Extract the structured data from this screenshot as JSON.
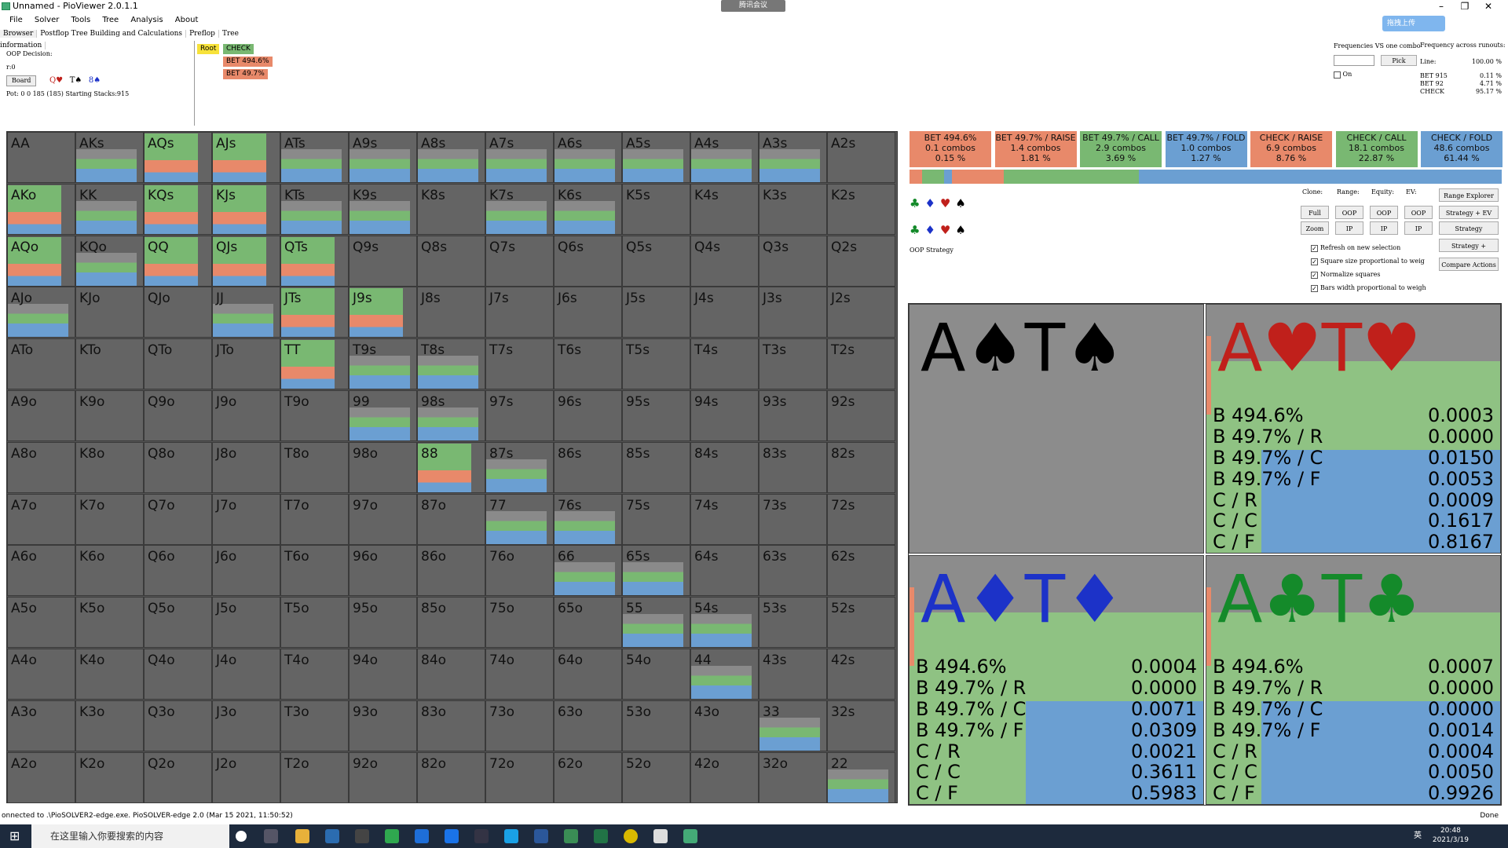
{
  "window": {
    "title": "Unnamed - PioViewer 2.0.1.1",
    "meeting_badge": "腾讯会议",
    "cloud_button": "拖拽上传"
  },
  "menu": [
    "File",
    "Solver",
    "Tools",
    "Tree",
    "Analysis",
    "About"
  ],
  "tabs": [
    "Browser",
    "Postflop Tree Building and Calculations",
    "Preflop",
    "Tree information"
  ],
  "left_info": {
    "decision": "OOP Decision:",
    "r": "r:0",
    "board_label": "Board",
    "board_cards": [
      "Q♥",
      "T♠",
      "8♠"
    ],
    "pot": "Pot: 0 0 185 (185) Starting Stacks:915"
  },
  "tree": {
    "root": "Root",
    "check": "CHECK",
    "bet1": "BET 494.6%",
    "bet2": "BET 49.7%"
  },
  "right_info": {
    "freq_title": "Frequencies VS one combo",
    "runouts_title": "Frequency across runouts:",
    "pick": "Pick",
    "on": "On",
    "line_label": "Line:",
    "line_value": "100.00 %",
    "rows": [
      {
        "label": "BET 915",
        "value": "0.11 %"
      },
      {
        "label": "BET 92",
        "value": "4.71 %"
      },
      {
        "label": "CHECK",
        "value": "95.17 %"
      }
    ]
  },
  "actions": [
    {
      "name": "BET 494.6%",
      "combos": "0.1 combos",
      "pct": "0.15 %",
      "color": "#e8896a"
    },
    {
      "name": "BET 49.7% / RAISE",
      "combos": "1.4 combos",
      "pct": "1.81 %",
      "color": "#e8896a"
    },
    {
      "name": "BET 49.7% / CALL",
      "combos": "2.9 combos",
      "pct": "3.69 %",
      "color": "#79b872"
    },
    {
      "name": "BET 49.7% / FOLD",
      "combos": "1.0 combos",
      "pct": "1.27 %",
      "color": "#6b9fd2"
    },
    {
      "name": "CHECK / RAISE",
      "combos": "6.9 combos",
      "pct": "8.76 %",
      "color": "#e8896a"
    },
    {
      "name": "CHECK / CALL",
      "combos": "18.1 combos",
      "pct": "22.87 %",
      "color": "#79b872"
    },
    {
      "name": "CHECK / FOLD",
      "combos": "48.6 combos",
      "pct": "61.44 %",
      "color": "#6b9fd2"
    }
  ],
  "suits": [
    "♣",
    "♦",
    "♥",
    "♠"
  ],
  "controls": {
    "clone": "Clone:",
    "range": "Range:",
    "equity": "Equity:",
    "ev": "EV:",
    "full": "Full",
    "zoom": "Zoom",
    "oop": "OOP",
    "ip": "IP",
    "range_explorer": "Range Explorer",
    "strategy_ev": "Strategy + EV",
    "strategy": "Strategy",
    "strategy_plus": "Strategy +",
    "compare": "Compare Actions",
    "checks": [
      "Refresh on new selection",
      "Square size proportional to weig",
      "Normalize squares",
      "Bars width proportional to weigh"
    ]
  },
  "oop_strategy": "OOP Strategy",
  "combos": [
    {
      "cards": [
        {
          "r": "A",
          "s": "♠"
        },
        {
          "r": "T",
          "s": "♠"
        }
      ],
      "color": "#000",
      "rows": []
    },
    {
      "cards": [
        {
          "r": "A",
          "s": "♥"
        },
        {
          "r": "T",
          "s": "♥"
        }
      ],
      "color": "#c0201b",
      "rows": [
        {
          "l": "B 494.6%",
          "v": "0.0003"
        },
        {
          "l": "B 49.7% / R",
          "v": "0.0000"
        },
        {
          "l": "B 49.7% / C",
          "v": "0.0150"
        },
        {
          "l": "B 49.7% / F",
          "v": "0.0053"
        },
        {
          "l": "C / R",
          "v": "0.0009"
        },
        {
          "l": "C / C",
          "v": "0.1617"
        },
        {
          "l": "C / F",
          "v": "0.8167"
        }
      ]
    },
    {
      "cards": [
        {
          "r": "A",
          "s": "♦"
        },
        {
          "r": "T",
          "s": "♦"
        }
      ],
      "color": "#1c32c8",
      "rows": [
        {
          "l": "B 494.6%",
          "v": "0.0004"
        },
        {
          "l": "B 49.7% / R",
          "v": "0.0000"
        },
        {
          "l": "B 49.7% / C",
          "v": "0.0071"
        },
        {
          "l": "B 49.7% / F",
          "v": "0.0309"
        },
        {
          "l": "C / R",
          "v": "0.0021"
        },
        {
          "l": "C / C",
          "v": "0.3611"
        },
        {
          "l": "C / F",
          "v": "0.5983"
        }
      ]
    },
    {
      "cards": [
        {
          "r": "A",
          "s": "♣"
        },
        {
          "r": "T",
          "s": "♣"
        }
      ],
      "color": "#148a2a",
      "rows": [
        {
          "l": "B 494.6%",
          "v": "0.0007"
        },
        {
          "l": "B 49.7% / R",
          "v": "0.0000"
        },
        {
          "l": "B 49.7% / C",
          "v": "0.0000"
        },
        {
          "l": "B 49.7% / F",
          "v": "0.0014"
        },
        {
          "l": "C / R",
          "v": "0.0004"
        },
        {
          "l": "C / C",
          "v": "0.0050"
        },
        {
          "l": "C / F",
          "v": "0.9926"
        }
      ]
    }
  ],
  "grid": [
    [
      "AA",
      "AKs",
      "AQs",
      "AJs",
      "ATs",
      "A9s",
      "A8s",
      "A7s",
      "A6s",
      "A5s",
      "A4s",
      "A3s",
      "A2s"
    ],
    [
      "AKo",
      "KK",
      "KQs",
      "KJs",
      "KTs",
      "K9s",
      "K8s",
      "K7s",
      "K6s",
      "K5s",
      "K4s",
      "K3s",
      "K2s"
    ],
    [
      "AQo",
      "KQo",
      "QQ",
      "QJs",
      "QTs",
      "Q9s",
      "Q8s",
      "Q7s",
      "Q6s",
      "Q5s",
      "Q4s",
      "Q3s",
      "Q2s"
    ],
    [
      "AJo",
      "KJo",
      "QJo",
      "JJ",
      "JTs",
      "J9s",
      "J8s",
      "J7s",
      "J6s",
      "J5s",
      "J4s",
      "J3s",
      "J2s"
    ],
    [
      "ATo",
      "KTo",
      "QTo",
      "JTo",
      "TT",
      "T9s",
      "T8s",
      "T7s",
      "T6s",
      "T5s",
      "T4s",
      "T3s",
      "T2s"
    ],
    [
      "A9o",
      "K9o",
      "Q9o",
      "J9o",
      "T9o",
      "99",
      "98s",
      "97s",
      "96s",
      "95s",
      "94s",
      "93s",
      "92s"
    ],
    [
      "A8o",
      "K8o",
      "Q8o",
      "J8o",
      "T8o",
      "98o",
      "88",
      "87s",
      "86s",
      "85s",
      "84s",
      "83s",
      "82s"
    ],
    [
      "A7o",
      "K7o",
      "Q7o",
      "J7o",
      "T7o",
      "97o",
      "87o",
      "77",
      "76s",
      "75s",
      "74s",
      "73s",
      "72s"
    ],
    [
      "A6o",
      "K6o",
      "Q6o",
      "J6o",
      "T6o",
      "96o",
      "86o",
      "76o",
      "66",
      "65s",
      "64s",
      "63s",
      "62s"
    ],
    [
      "A5o",
      "K5o",
      "Q5o",
      "J5o",
      "T5o",
      "95o",
      "85o",
      "75o",
      "65o",
      "55",
      "54s",
      "53s",
      "52s"
    ],
    [
      "A4o",
      "K4o",
      "Q4o",
      "J4o",
      "T4o",
      "94o",
      "84o",
      "74o",
      "64o",
      "54o",
      "44",
      "43s",
      "42s"
    ],
    [
      "A3o",
      "K3o",
      "Q3o",
      "J3o",
      "T3o",
      "93o",
      "83o",
      "73o",
      "63o",
      "53o",
      "43o",
      "33",
      "32s"
    ],
    [
      "A2o",
      "K2o",
      "Q2o",
      "J2o",
      "T2o",
      "92o",
      "82o",
      "72o",
      "62o",
      "52o",
      "42o",
      "32o",
      "22"
    ]
  ],
  "status": "onnected to .\\PioSOLVER2-edge.exe. PioSOLVER-edge 2.0 (Mar 15 2021, 11:50:52)",
  "status_right": "Done",
  "taskbar": {
    "search": "在这里输入你要搜索的内容",
    "time": "20:48",
    "date": "2021/3/19",
    "ime": "英"
  }
}
